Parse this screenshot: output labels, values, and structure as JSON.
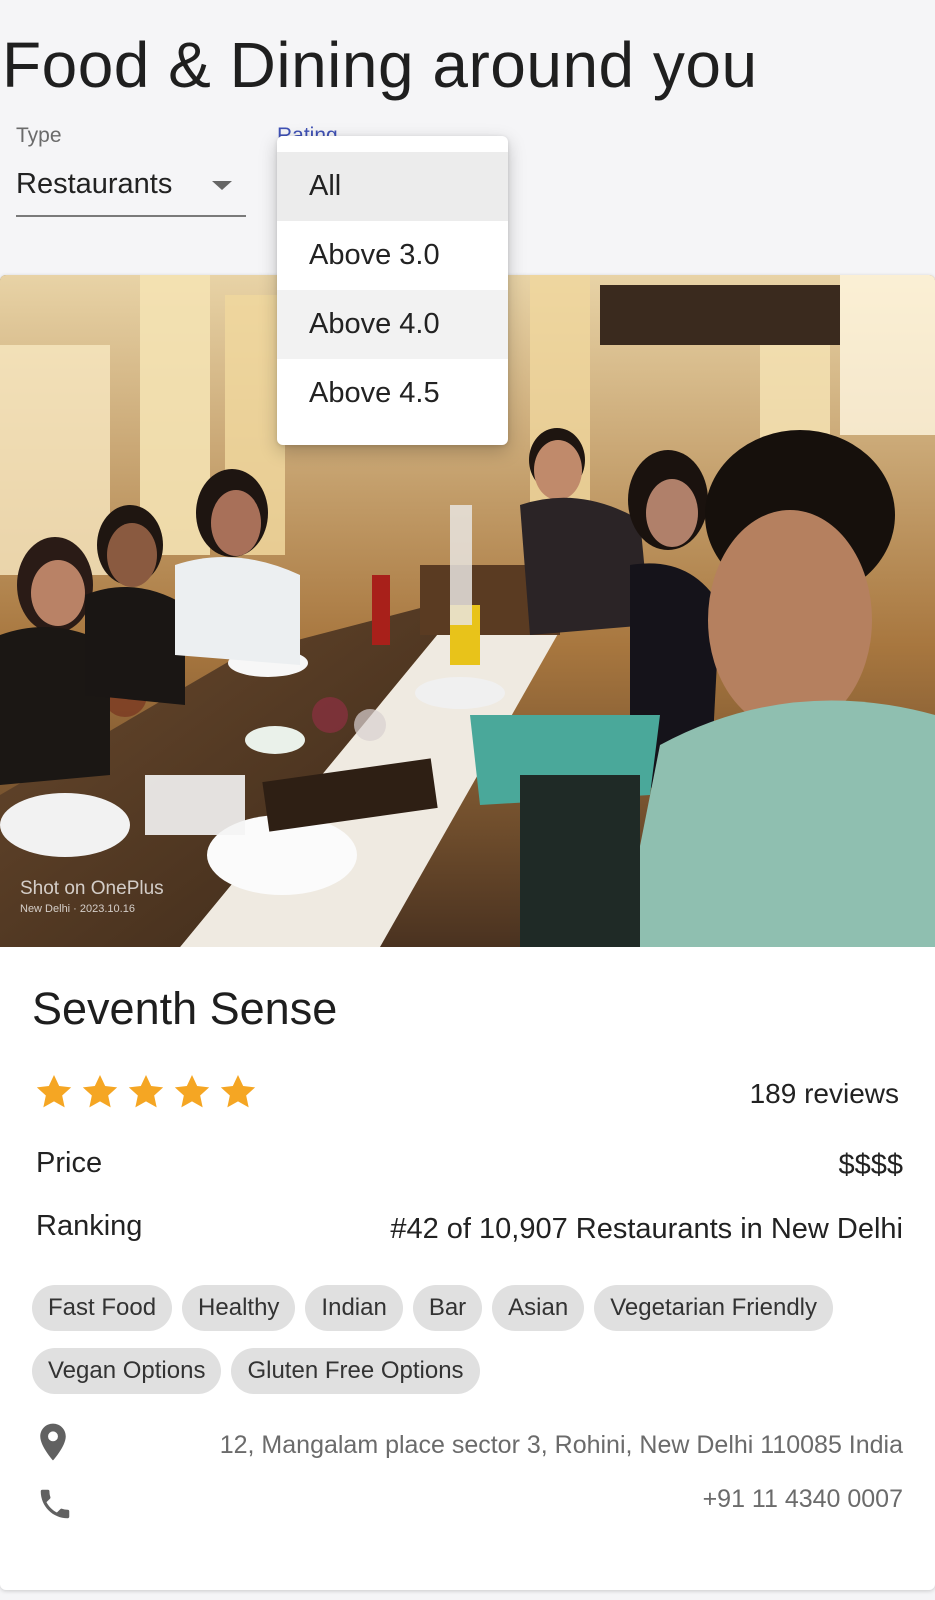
{
  "page": {
    "title": "Food & Dining around you"
  },
  "filters": {
    "type": {
      "label": "Type",
      "value": "Restaurants"
    },
    "rating": {
      "label": "Rating",
      "options": [
        "All",
        "Above 3.0",
        "Above 4.0",
        "Above 4.5"
      ],
      "selected": "All"
    }
  },
  "restaurant": {
    "photo": {
      "watermark_line1": "Shot on OnePlus",
      "watermark_line2": "New Delhi · 2023.10.16"
    },
    "name": "Seventh Sense",
    "rating_stars": 5,
    "reviews": "189 reviews",
    "price_label": "Price",
    "price_value": "$$$$",
    "ranking_label": "Ranking",
    "ranking_value": "#42 of 10,907 Restaurants in New Delhi",
    "cuisines": [
      "Fast Food",
      "Healthy",
      "Indian",
      "Bar",
      "Asian",
      "Vegetarian Friendly",
      "Vegan Options",
      "Gluten Free Options"
    ],
    "address": "12, Mangalam place sector 3, Rohini, New Delhi 110085 India",
    "phone": "+91 11 4340 0007"
  },
  "colors": {
    "star": "#f5a623",
    "accent": "#3f51b5",
    "chip_bg": "#e0e0e0",
    "icon": "#616161"
  },
  "icons": {
    "caret": "caret-down-icon",
    "star": "star-icon",
    "location": "location-pin-icon",
    "phone": "phone-icon"
  }
}
